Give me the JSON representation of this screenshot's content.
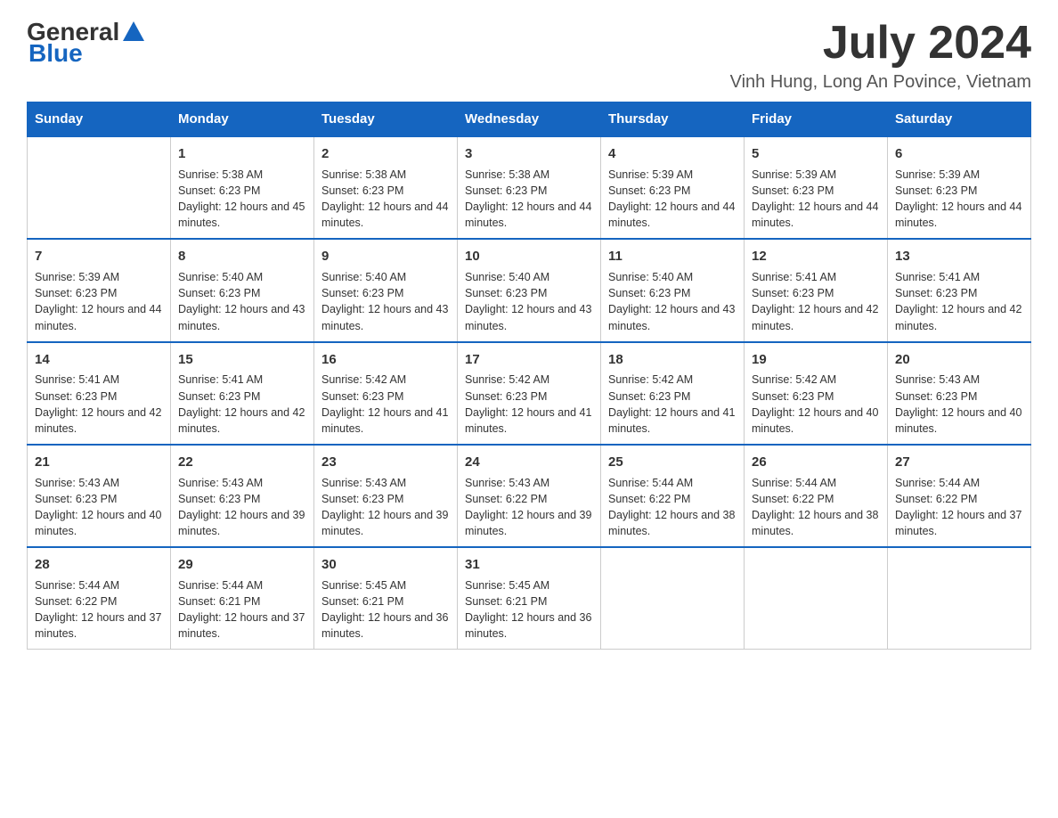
{
  "logo": {
    "general": "General",
    "blue": "Blue"
  },
  "title": {
    "month_year": "July 2024",
    "location": "Vinh Hung, Long An Povince, Vietnam"
  },
  "days_of_week": [
    "Sunday",
    "Monday",
    "Tuesday",
    "Wednesday",
    "Thursday",
    "Friday",
    "Saturday"
  ],
  "weeks": [
    {
      "days": [
        {
          "num": "",
          "sunrise": "",
          "sunset": "",
          "daylight": ""
        },
        {
          "num": "1",
          "sunrise": "Sunrise: 5:38 AM",
          "sunset": "Sunset: 6:23 PM",
          "daylight": "Daylight: 12 hours and 45 minutes."
        },
        {
          "num": "2",
          "sunrise": "Sunrise: 5:38 AM",
          "sunset": "Sunset: 6:23 PM",
          "daylight": "Daylight: 12 hours and 44 minutes."
        },
        {
          "num": "3",
          "sunrise": "Sunrise: 5:38 AM",
          "sunset": "Sunset: 6:23 PM",
          "daylight": "Daylight: 12 hours and 44 minutes."
        },
        {
          "num": "4",
          "sunrise": "Sunrise: 5:39 AM",
          "sunset": "Sunset: 6:23 PM",
          "daylight": "Daylight: 12 hours and 44 minutes."
        },
        {
          "num": "5",
          "sunrise": "Sunrise: 5:39 AM",
          "sunset": "Sunset: 6:23 PM",
          "daylight": "Daylight: 12 hours and 44 minutes."
        },
        {
          "num": "6",
          "sunrise": "Sunrise: 5:39 AM",
          "sunset": "Sunset: 6:23 PM",
          "daylight": "Daylight: 12 hours and 44 minutes."
        }
      ]
    },
    {
      "days": [
        {
          "num": "7",
          "sunrise": "Sunrise: 5:39 AM",
          "sunset": "Sunset: 6:23 PM",
          "daylight": "Daylight: 12 hours and 44 minutes."
        },
        {
          "num": "8",
          "sunrise": "Sunrise: 5:40 AM",
          "sunset": "Sunset: 6:23 PM",
          "daylight": "Daylight: 12 hours and 43 minutes."
        },
        {
          "num": "9",
          "sunrise": "Sunrise: 5:40 AM",
          "sunset": "Sunset: 6:23 PM",
          "daylight": "Daylight: 12 hours and 43 minutes."
        },
        {
          "num": "10",
          "sunrise": "Sunrise: 5:40 AM",
          "sunset": "Sunset: 6:23 PM",
          "daylight": "Daylight: 12 hours and 43 minutes."
        },
        {
          "num": "11",
          "sunrise": "Sunrise: 5:40 AM",
          "sunset": "Sunset: 6:23 PM",
          "daylight": "Daylight: 12 hours and 43 minutes."
        },
        {
          "num": "12",
          "sunrise": "Sunrise: 5:41 AM",
          "sunset": "Sunset: 6:23 PM",
          "daylight": "Daylight: 12 hours and 42 minutes."
        },
        {
          "num": "13",
          "sunrise": "Sunrise: 5:41 AM",
          "sunset": "Sunset: 6:23 PM",
          "daylight": "Daylight: 12 hours and 42 minutes."
        }
      ]
    },
    {
      "days": [
        {
          "num": "14",
          "sunrise": "Sunrise: 5:41 AM",
          "sunset": "Sunset: 6:23 PM",
          "daylight": "Daylight: 12 hours and 42 minutes."
        },
        {
          "num": "15",
          "sunrise": "Sunrise: 5:41 AM",
          "sunset": "Sunset: 6:23 PM",
          "daylight": "Daylight: 12 hours and 42 minutes."
        },
        {
          "num": "16",
          "sunrise": "Sunrise: 5:42 AM",
          "sunset": "Sunset: 6:23 PM",
          "daylight": "Daylight: 12 hours and 41 minutes."
        },
        {
          "num": "17",
          "sunrise": "Sunrise: 5:42 AM",
          "sunset": "Sunset: 6:23 PM",
          "daylight": "Daylight: 12 hours and 41 minutes."
        },
        {
          "num": "18",
          "sunrise": "Sunrise: 5:42 AM",
          "sunset": "Sunset: 6:23 PM",
          "daylight": "Daylight: 12 hours and 41 minutes."
        },
        {
          "num": "19",
          "sunrise": "Sunrise: 5:42 AM",
          "sunset": "Sunset: 6:23 PM",
          "daylight": "Daylight: 12 hours and 40 minutes."
        },
        {
          "num": "20",
          "sunrise": "Sunrise: 5:43 AM",
          "sunset": "Sunset: 6:23 PM",
          "daylight": "Daylight: 12 hours and 40 minutes."
        }
      ]
    },
    {
      "days": [
        {
          "num": "21",
          "sunrise": "Sunrise: 5:43 AM",
          "sunset": "Sunset: 6:23 PM",
          "daylight": "Daylight: 12 hours and 40 minutes."
        },
        {
          "num": "22",
          "sunrise": "Sunrise: 5:43 AM",
          "sunset": "Sunset: 6:23 PM",
          "daylight": "Daylight: 12 hours and 39 minutes."
        },
        {
          "num": "23",
          "sunrise": "Sunrise: 5:43 AM",
          "sunset": "Sunset: 6:23 PM",
          "daylight": "Daylight: 12 hours and 39 minutes."
        },
        {
          "num": "24",
          "sunrise": "Sunrise: 5:43 AM",
          "sunset": "Sunset: 6:22 PM",
          "daylight": "Daylight: 12 hours and 39 minutes."
        },
        {
          "num": "25",
          "sunrise": "Sunrise: 5:44 AM",
          "sunset": "Sunset: 6:22 PM",
          "daylight": "Daylight: 12 hours and 38 minutes."
        },
        {
          "num": "26",
          "sunrise": "Sunrise: 5:44 AM",
          "sunset": "Sunset: 6:22 PM",
          "daylight": "Daylight: 12 hours and 38 minutes."
        },
        {
          "num": "27",
          "sunrise": "Sunrise: 5:44 AM",
          "sunset": "Sunset: 6:22 PM",
          "daylight": "Daylight: 12 hours and 37 minutes."
        }
      ]
    },
    {
      "days": [
        {
          "num": "28",
          "sunrise": "Sunrise: 5:44 AM",
          "sunset": "Sunset: 6:22 PM",
          "daylight": "Daylight: 12 hours and 37 minutes."
        },
        {
          "num": "29",
          "sunrise": "Sunrise: 5:44 AM",
          "sunset": "Sunset: 6:21 PM",
          "daylight": "Daylight: 12 hours and 37 minutes."
        },
        {
          "num": "30",
          "sunrise": "Sunrise: 5:45 AM",
          "sunset": "Sunset: 6:21 PM",
          "daylight": "Daylight: 12 hours and 36 minutes."
        },
        {
          "num": "31",
          "sunrise": "Sunrise: 5:45 AM",
          "sunset": "Sunset: 6:21 PM",
          "daylight": "Daylight: 12 hours and 36 minutes."
        },
        {
          "num": "",
          "sunrise": "",
          "sunset": "",
          "daylight": ""
        },
        {
          "num": "",
          "sunrise": "",
          "sunset": "",
          "daylight": ""
        },
        {
          "num": "",
          "sunrise": "",
          "sunset": "",
          "daylight": ""
        }
      ]
    }
  ]
}
